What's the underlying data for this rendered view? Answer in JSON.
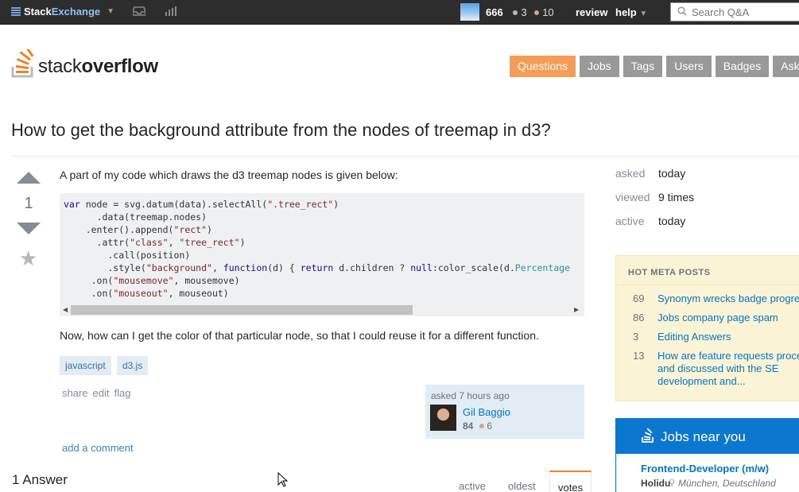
{
  "topbar": {
    "brand_stack": "Stack",
    "brand_exchange": "Exchange",
    "inbox_icon": "inbox-icon",
    "achievements_icon": "achievements-icon",
    "reputation": "666",
    "silver_badges": "3",
    "bronze_badges": "10",
    "review_label": "review",
    "help_label": "help",
    "search_placeholder": "Search Q&A",
    "colors": {
      "silver": "#b4b8bc",
      "bronze": "#d1a684",
      "bar": "#2d2d2d"
    }
  },
  "header": {
    "logo_stack": "stack",
    "logo_overflow": "overflow",
    "nav": [
      "Questions",
      "Jobs",
      "Tags",
      "Users",
      "Badges",
      "Ask"
    ],
    "active_nav": "Questions",
    "accent_color": "#f69c55"
  },
  "question": {
    "title": "How to get the background attribute from the nodes of treemap in d3?",
    "votes": "1",
    "intro": "A part of my code which draws the d3 treemap nodes is given below:",
    "code_lines": [
      "var node = svg.datum(data).selectAll(\".tree_rect\")",
      "      .data(treemap.nodes)",
      "    .enter().append(\"rect\")",
      "      .attr(\"class\", \"tree_rect\")",
      "        .call(position)",
      "        .style(\"background\", function(d) { return d.children ? null:color_scale(d.Percentage",
      "     .on(\"mousemove\", mousemove)",
      "     .on(\"mouseout\", mouseout)"
    ],
    "followup": "Now, how can I get the color of that particular node, so that I could reuse it for a different function.",
    "tags": [
      "javascript",
      "d3.js"
    ],
    "menu": {
      "share": "share",
      "edit": "edit",
      "flag": "flag"
    },
    "owner": {
      "asked": "asked 7 hours ago",
      "name": "Gil Baggio",
      "reputation": "84",
      "bronze": "6"
    },
    "add_comment": "add a comment"
  },
  "answers": {
    "heading": "1 Answer",
    "sort_tabs": [
      "active",
      "oldest",
      "votes"
    ],
    "active_sort": "votes"
  },
  "sidebar": {
    "stats": [
      {
        "label": "asked",
        "value": "today"
      },
      {
        "label": "viewed",
        "value": "9 times"
      },
      {
        "label": "active",
        "value": "today"
      }
    ],
    "meta_heading": "HOT META POSTS",
    "meta_posts": [
      {
        "count": "69",
        "title": "Synonym wrecks badge progre"
      },
      {
        "count": "86",
        "title": "Jobs company page spam"
      },
      {
        "count": "3",
        "title": "Editing Answers"
      },
      {
        "count": "13",
        "title": "How are feature requests proce\nand discussed with the SE\ndevelopment and..."
      }
    ],
    "jobs_heading": "Jobs near you",
    "job": {
      "title": "Frontend-Developer (m/w)",
      "company": "Holidu",
      "location": "München, Deutschland"
    }
  }
}
